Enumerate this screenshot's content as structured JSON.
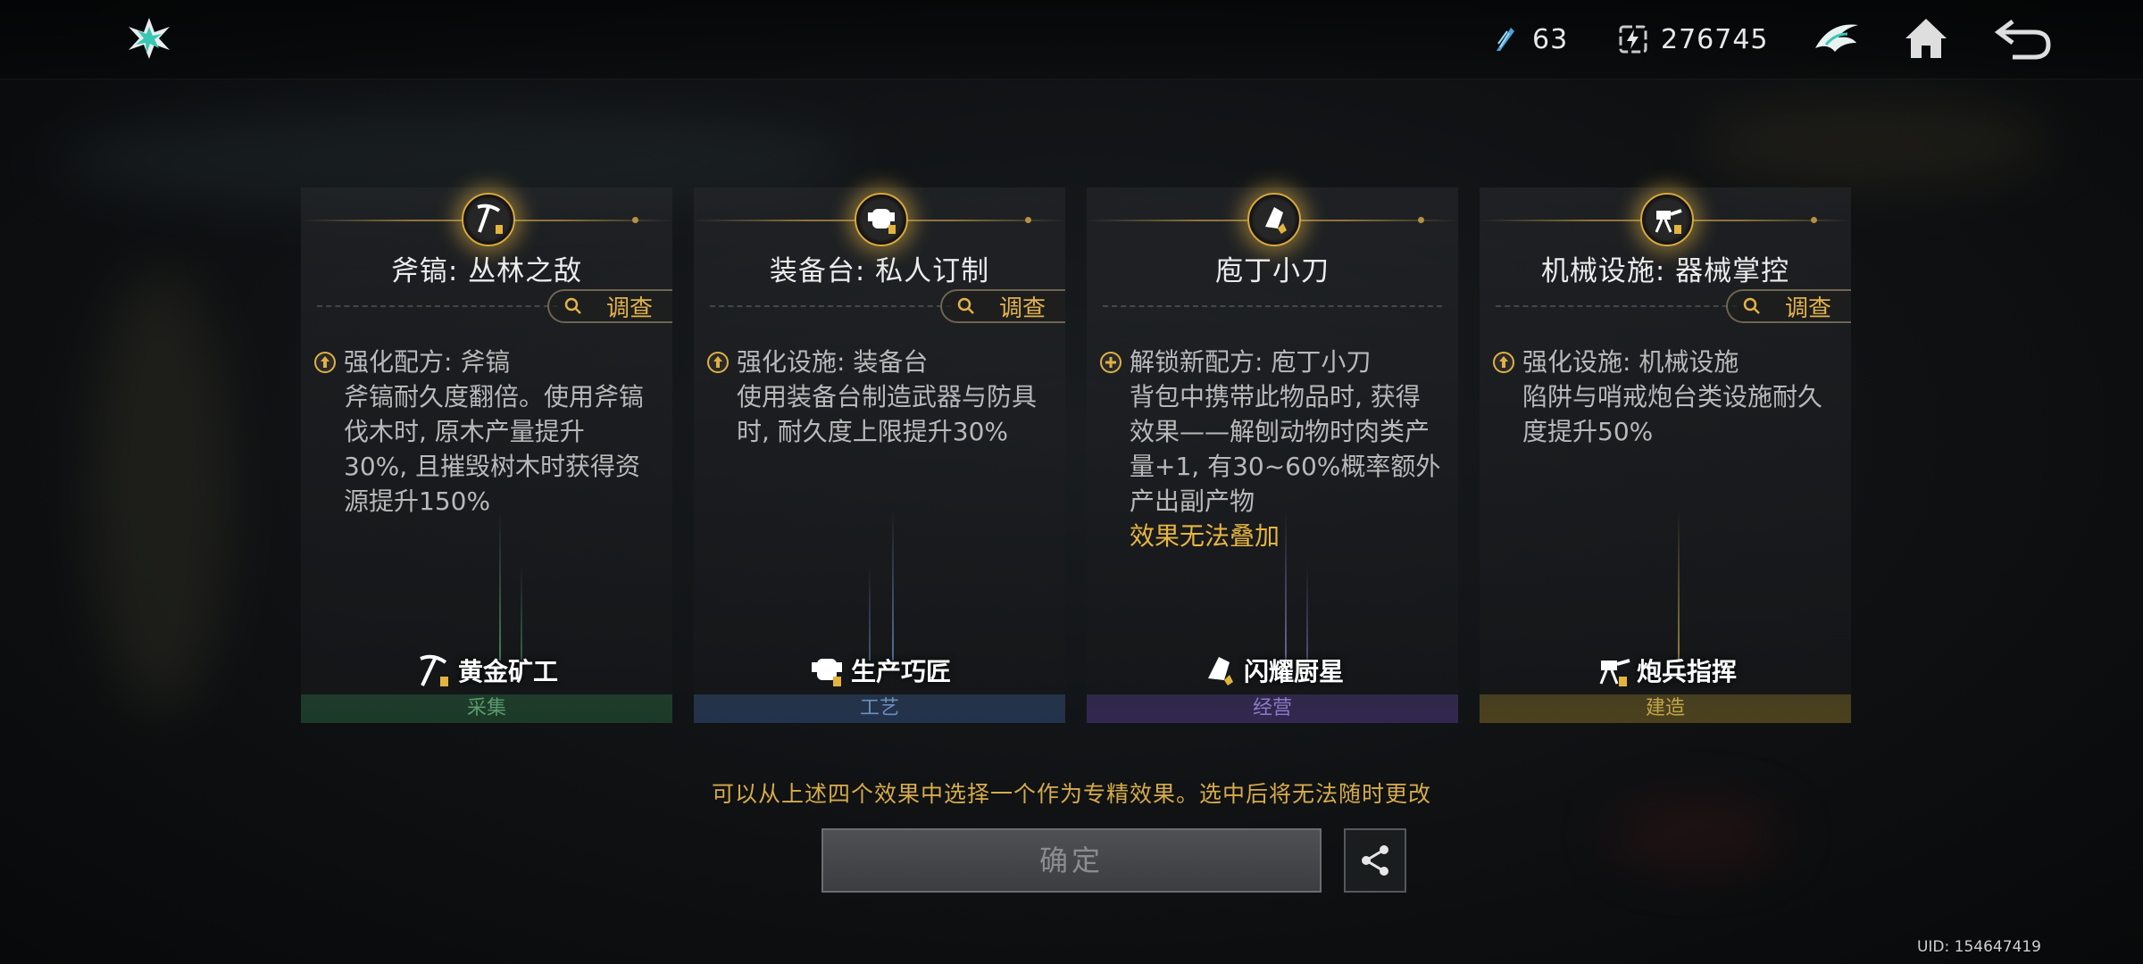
{
  "topbar": {
    "currency_a": {
      "icon": "feather-crystal-icon",
      "value": "63"
    },
    "currency_b": {
      "icon": "lightning-box-icon",
      "value": "276745"
    },
    "emblem_icon": "winged-emblem-icon",
    "home_icon": "home-icon",
    "back_icon": "back-arrow-icon"
  },
  "cards": [
    {
      "title": "斧镐: 丛林之敌",
      "inspect_label": "调查",
      "effect_head": "强化配方: 斧镐",
      "effect_desc": [
        "斧镐耐久度翻倍。使用斧镐",
        "伐木时, 原木产量提升",
        "30%, 且摧毁树木时获得资",
        "源提升150%"
      ],
      "badge": "黄金矿工",
      "category": "采集",
      "category_color": "#5a9a6a"
    },
    {
      "title": "装备台: 私人订制",
      "inspect_label": "调查",
      "effect_head": "强化设施: 装备台",
      "effect_desc": [
        "使用装备台制造武器与防具",
        "时, 耐久度上限提升30%"
      ],
      "badge": "生产巧匠",
      "category": "工艺",
      "category_color": "#6a8fc0"
    },
    {
      "title": "庖丁小刀",
      "effect_head": "解锁新配方: 庖丁小刀",
      "effect_desc": [
        "背包中携带此物品时, 获得",
        "效果——解刨动物时肉类产",
        "量+1, 有30~60%概率额外",
        "产出副产物"
      ],
      "effect_warn": "效果无法叠加",
      "badge": "闪耀厨星",
      "category": "经营",
      "category_color": "#8a7ac8"
    },
    {
      "title": "机械设施: 器械掌控",
      "inspect_label": "调查",
      "effect_head": "强化设施: 机械设施",
      "effect_desc": [
        "陷阱与哨戒炮台类设施耐久",
        "度提升50%"
      ],
      "badge": "炮兵指挥",
      "category": "建造",
      "category_color": "#c4a648"
    }
  ],
  "notice": "可以从上述四个效果中选择一个作为专精效果。选中后将无法随时更改",
  "confirm_label": "确定",
  "share_icon": "share-icon",
  "uid": "UID: 154647419"
}
